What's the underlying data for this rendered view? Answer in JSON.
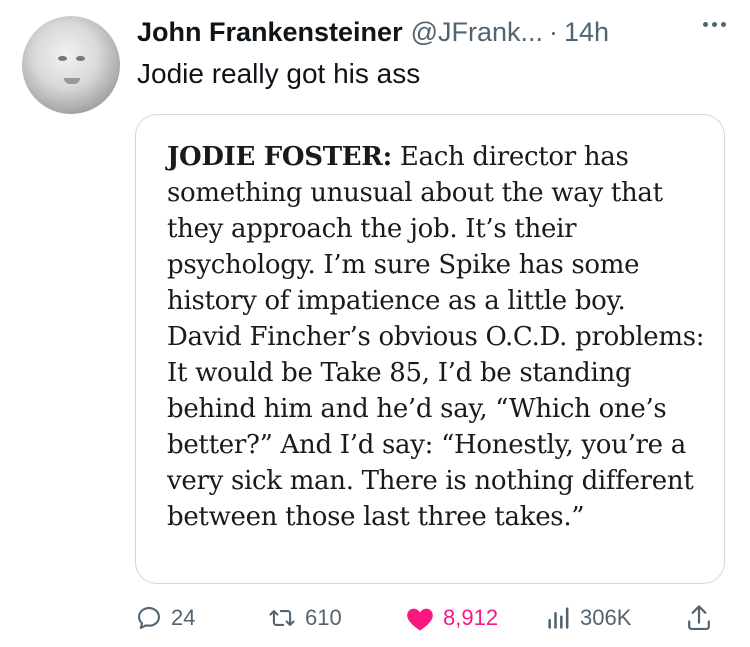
{
  "author": {
    "name": "John Frankensteiner",
    "handle": "@JFrank...",
    "separator": "·",
    "time": "14h"
  },
  "tweet": {
    "text": "Jodie really got his ass"
  },
  "quote_image": {
    "speaker": "JODIE FOSTER:",
    "body": " Each director has something unusual about the way that they approach the job. It’s their psychology. I’m sure Spike has some history of impatience as a little boy. David Fincher’s obvious O.C.D. problems: It would be Take 85, I’d be standing behind him and he’d say, “Which one’s better?” And I’d say: “Honestly, you’re a very sick man. There is nothing different between those last three takes.”"
  },
  "actions": {
    "replies": "24",
    "retweets": "610",
    "likes": "8,912",
    "views": "306K"
  },
  "icons": {
    "reply": "reply-bubble-icon",
    "retweet": "retweet-icon",
    "like": "heart-icon",
    "views": "views-bars-icon",
    "share": "share-upload-icon",
    "more": "more-dots-icon"
  },
  "colors": {
    "text": "#0f1419",
    "secondary": "#536471",
    "like": "#f91880",
    "border": "#cfd9de"
  }
}
